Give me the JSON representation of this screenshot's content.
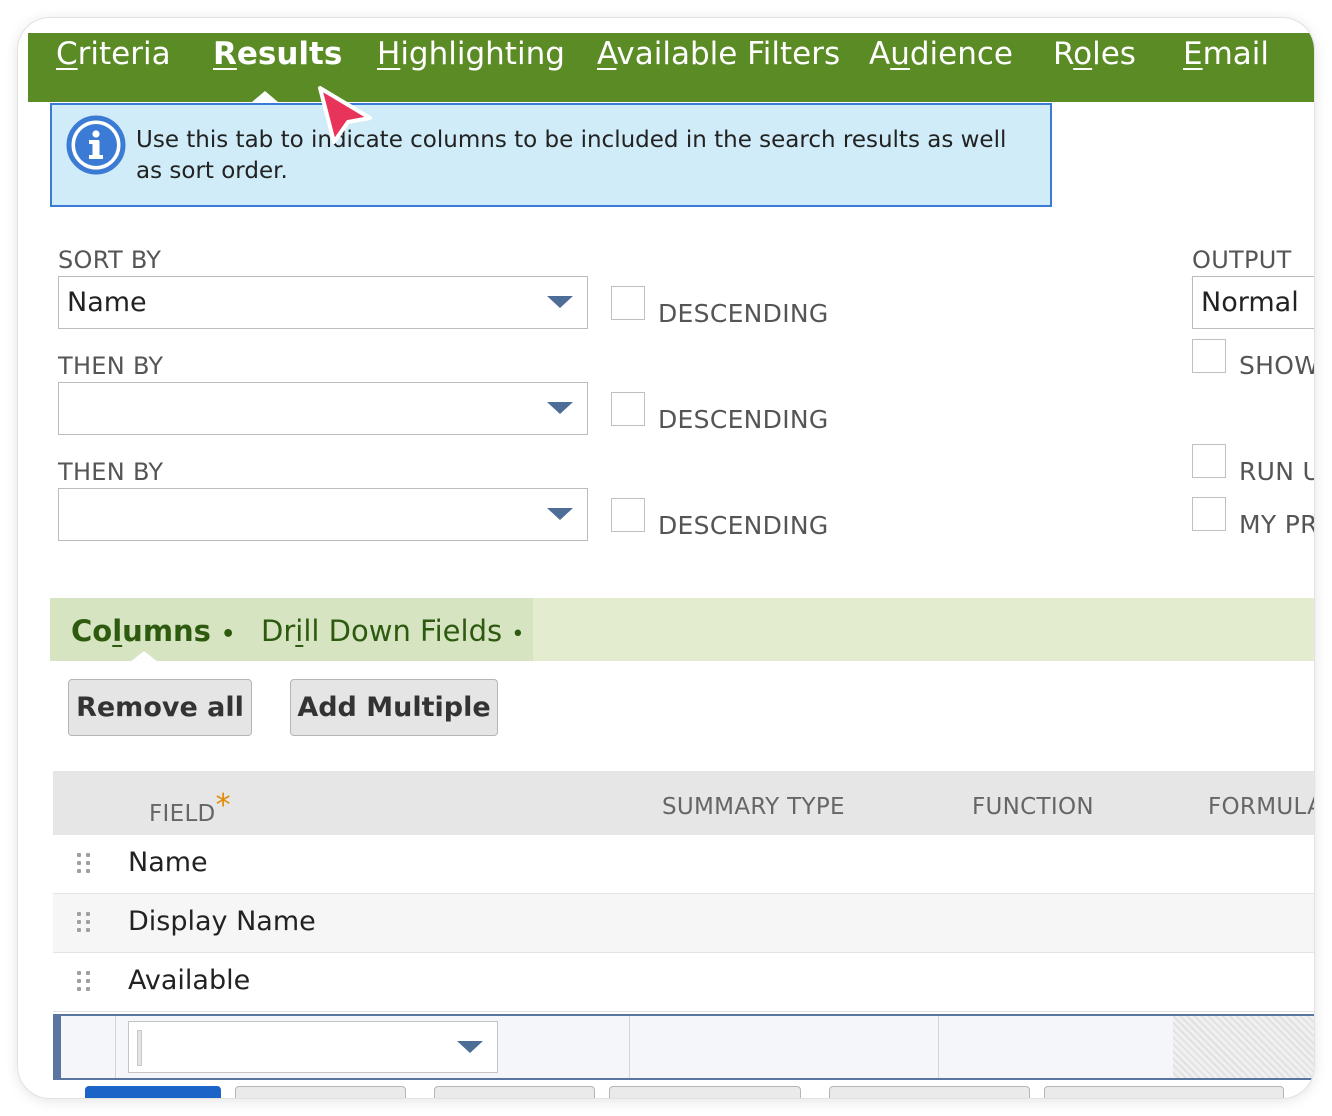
{
  "tabs": [
    {
      "label": "Criteria",
      "pre": "",
      "acc": "C",
      "post": "riteria",
      "active": false
    },
    {
      "label": "Results",
      "pre": "",
      "acc": "R",
      "post": "esults",
      "active": true
    },
    {
      "label": "Highlighting",
      "pre": "",
      "acc": "H",
      "post": "ighlighting",
      "active": false
    },
    {
      "label": "Available Filters",
      "pre": "",
      "acc": "A",
      "post": "vailable Filters",
      "active": false
    },
    {
      "label": "Audience",
      "pre": "A",
      "acc": "u",
      "post": "dience",
      "active": false
    },
    {
      "label": "Roles",
      "pre": "R",
      "acc": "o",
      "post": "les",
      "active": false
    },
    {
      "label": "Email",
      "pre": "",
      "acc": "E",
      "post": "mail",
      "active": false
    }
  ],
  "info": {
    "icon": "info-icon",
    "message": "Use this tab to indicate columns to be included in the search results as well as sort order."
  },
  "sort": {
    "sort_by_label": "SORT BY",
    "sort_by_value": "Name",
    "then_by_label_1": "THEN BY",
    "then_by_value_1": "",
    "then_by_label_2": "THEN BY",
    "then_by_value_2": "",
    "descending_label": "DESCENDING"
  },
  "output": {
    "output_type_label": "OUTPUT T",
    "output_type_value": "Normal",
    "show_label": "SHOW",
    "run_label": "RUN U",
    "my_pr_label": "MY PR"
  },
  "subtabs": [
    {
      "label": "Columns",
      "pre": "Co",
      "acc": "l",
      "post": "umns",
      "dot": "•",
      "active": true
    },
    {
      "label": "Drill Down Fields",
      "pre": "Dr",
      "acc": "i",
      "post": "ll Down Fields",
      "dot": "•",
      "active": false
    }
  ],
  "buttons": {
    "remove_all": "Remove all",
    "add_multiple": "Add Multiple"
  },
  "table": {
    "headers": {
      "field": "FIELD",
      "required_mark": "*",
      "summary_type": "SUMMARY TYPE",
      "function": "FUNCTION",
      "formula": "FORMULA"
    },
    "rows": [
      {
        "field": "Name"
      },
      {
        "field": "Display Name"
      },
      {
        "field": "Available"
      }
    ],
    "edit_row_field_value": ""
  },
  "colors": {
    "tab_bar": "#5b8b24",
    "info_bg": "#d0ecf8",
    "info_border": "#3b7bd5",
    "subtab_bar": "#e3eccf",
    "pointer": "#e8345a",
    "primary_button": "#1b63c6"
  }
}
